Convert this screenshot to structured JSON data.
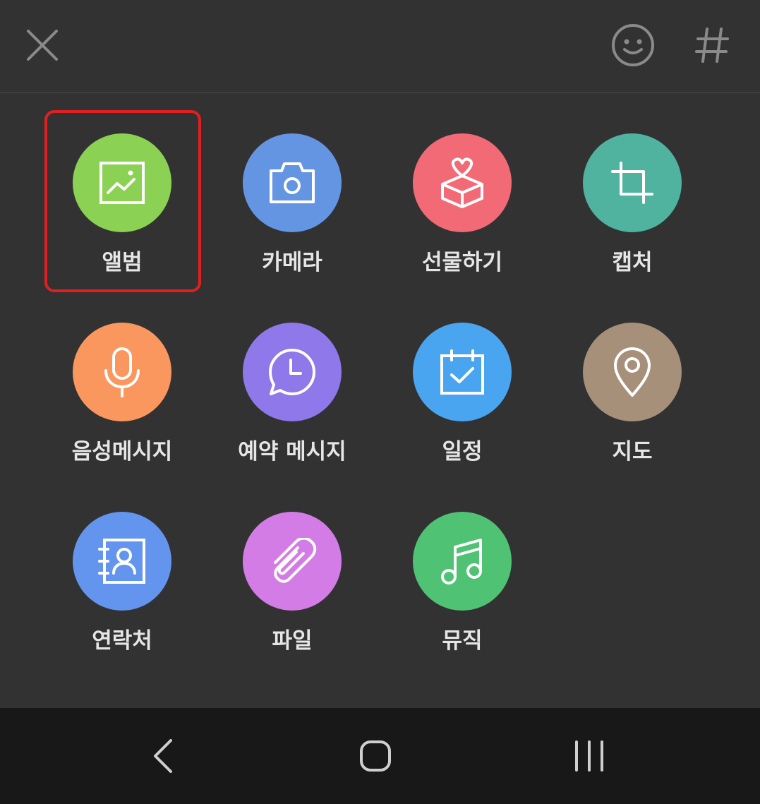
{
  "top_bar": {
    "close_icon": "close-icon",
    "emoticon_icon": "emoticon-icon",
    "hashtag_icon": "hashtag-icon"
  },
  "attachments": {
    "items": [
      {
        "label": "앨범",
        "icon": "image-icon",
        "color": "#8bd153",
        "selected": true
      },
      {
        "label": "카메라",
        "icon": "camera-icon",
        "color": "#6495e3",
        "selected": false
      },
      {
        "label": "선물하기",
        "icon": "gift-box-icon",
        "color": "#f26a76",
        "selected": false
      },
      {
        "label": "캡처",
        "icon": "crop-icon",
        "color": "#4fb39f",
        "selected": false
      },
      {
        "label": "음성메시지",
        "icon": "microphone-icon",
        "color": "#f9975f",
        "selected": false
      },
      {
        "label": "예약 메시지",
        "icon": "clock-bubble-icon",
        "color": "#8e78ea",
        "selected": false
      },
      {
        "label": "일정",
        "icon": "calendar-check-icon",
        "color": "#4aa5f0",
        "selected": false
      },
      {
        "label": "지도",
        "icon": "map-pin-icon",
        "color": "#a69079",
        "selected": false
      },
      {
        "label": "연락처",
        "icon": "contact-book-icon",
        "color": "#6495ee",
        "selected": false
      },
      {
        "label": "파일",
        "icon": "paperclip-icon",
        "color": "#d37ce6",
        "selected": false
      },
      {
        "label": "뮤직",
        "icon": "music-note-icon",
        "color": "#4fc274",
        "selected": false
      }
    ]
  },
  "nav_bar": {
    "back_icon": "back-icon",
    "home_icon": "home-icon",
    "recents_icon": "recents-icon"
  },
  "colors": {
    "background": "#323232",
    "nav_background": "#181818",
    "highlight": "#e02020",
    "label": "#e6e6e6",
    "toolbar_icon": "#8a8a8a"
  }
}
